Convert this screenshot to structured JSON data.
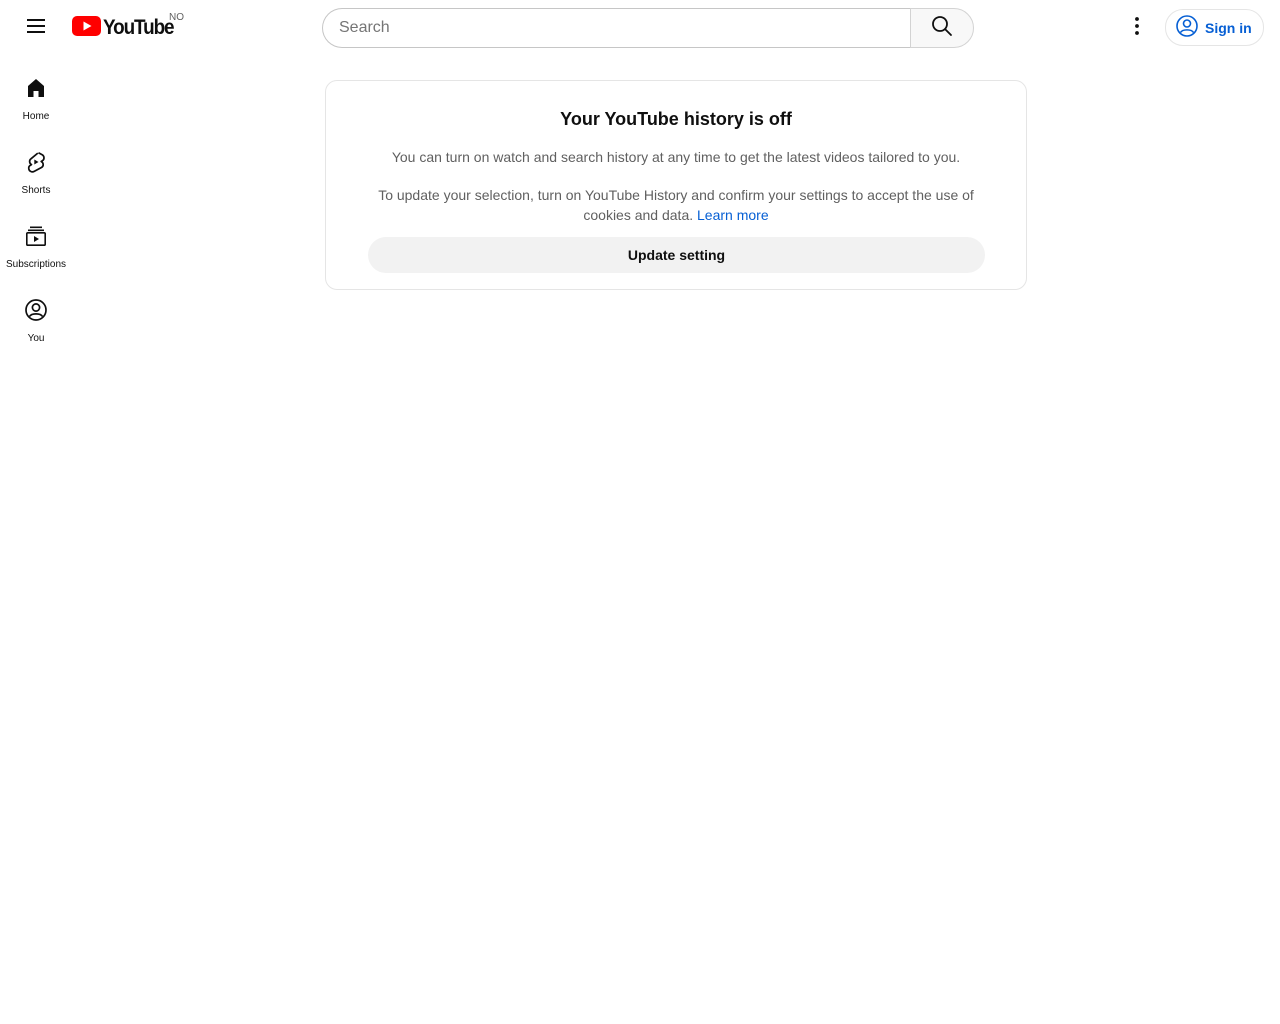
{
  "header": {
    "logo_text": "YouTube",
    "country_code": "NO",
    "search": {
      "placeholder": "Search",
      "value": ""
    },
    "sign_in_label": "Sign in"
  },
  "guide": {
    "items": [
      {
        "label": "Home",
        "icon": "home-icon"
      },
      {
        "label": "Shorts",
        "icon": "shorts-icon"
      },
      {
        "label": "Subscriptions",
        "icon": "subscriptions-icon"
      },
      {
        "label": "You",
        "icon": "account-icon"
      }
    ]
  },
  "history_card": {
    "title": "Your YouTube history is off",
    "description": "You can turn on watch and search history at any time to get the latest videos tailored to you.",
    "selection_text": "To update your selection, turn on YouTube History and confirm your settings to accept the use of cookies and data.",
    "learn_more_label": "Learn more",
    "update_button_label": "Update setting"
  },
  "colors": {
    "brand_red": "#ff0000",
    "link_blue": "#065fd4",
    "text_primary": "#0f0f0f",
    "text_secondary": "#606060"
  }
}
